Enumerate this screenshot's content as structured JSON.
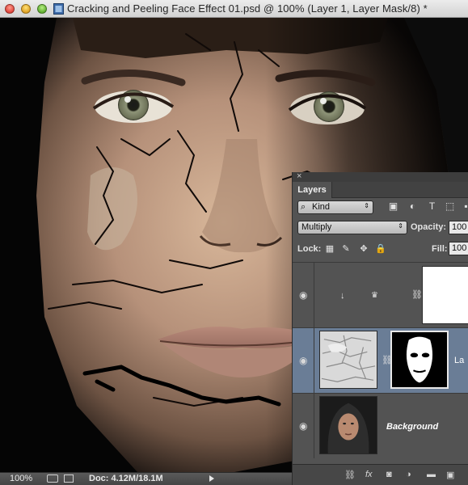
{
  "window": {
    "title": "Cracking and Peeling Face Effect 01.psd @ 100% (Layer 1, Layer Mask/8) *"
  },
  "status_bar": {
    "zoom": "100%",
    "doc_size": "Doc: 4.12M/18.1M"
  },
  "layers_panel": {
    "close_glyph": "×",
    "tab_label": "Layers",
    "filter": {
      "label": "Kind",
      "search_glyph": "⌕",
      "arrow": "⇕"
    },
    "filter_icons": [
      "image-filter-icon",
      "adjustment-filter-icon",
      "type-filter-icon",
      "shape-filter-icon",
      "smart-object-filter-icon"
    ],
    "filter_glyphs": [
      "▣",
      "◐",
      "T",
      "⬚",
      "▪"
    ],
    "blend_mode": "Multiply",
    "blend_arrow": "⇕",
    "opacity_label": "Opacity:",
    "opacity_value": "100",
    "lock_label": "Lock:",
    "lock_glyphs": [
      "▦",
      "✎",
      "✥",
      "🔒"
    ],
    "fill_label": "Fill:",
    "fill_value": "100",
    "layers": [
      {
        "name": "",
        "visible": true,
        "thumb": "white",
        "eye": "◉",
        "clip": "↓",
        "crown": "♛",
        "link": "⛓"
      },
      {
        "name": "La",
        "visible": true,
        "thumb": "crack-texture",
        "selected": true,
        "eye": "◉",
        "link": "⛓"
      },
      {
        "name": "Background",
        "visible": true,
        "thumb": "portrait",
        "eye": "◉"
      }
    ],
    "footer_glyphs": [
      "⛓",
      "fx",
      "◙",
      "◑",
      "▬",
      "▣"
    ]
  },
  "colors": {
    "panel_bg": "#535353",
    "selected_row": "#6a7d96",
    "title_bar": "#e0e0e0"
  }
}
